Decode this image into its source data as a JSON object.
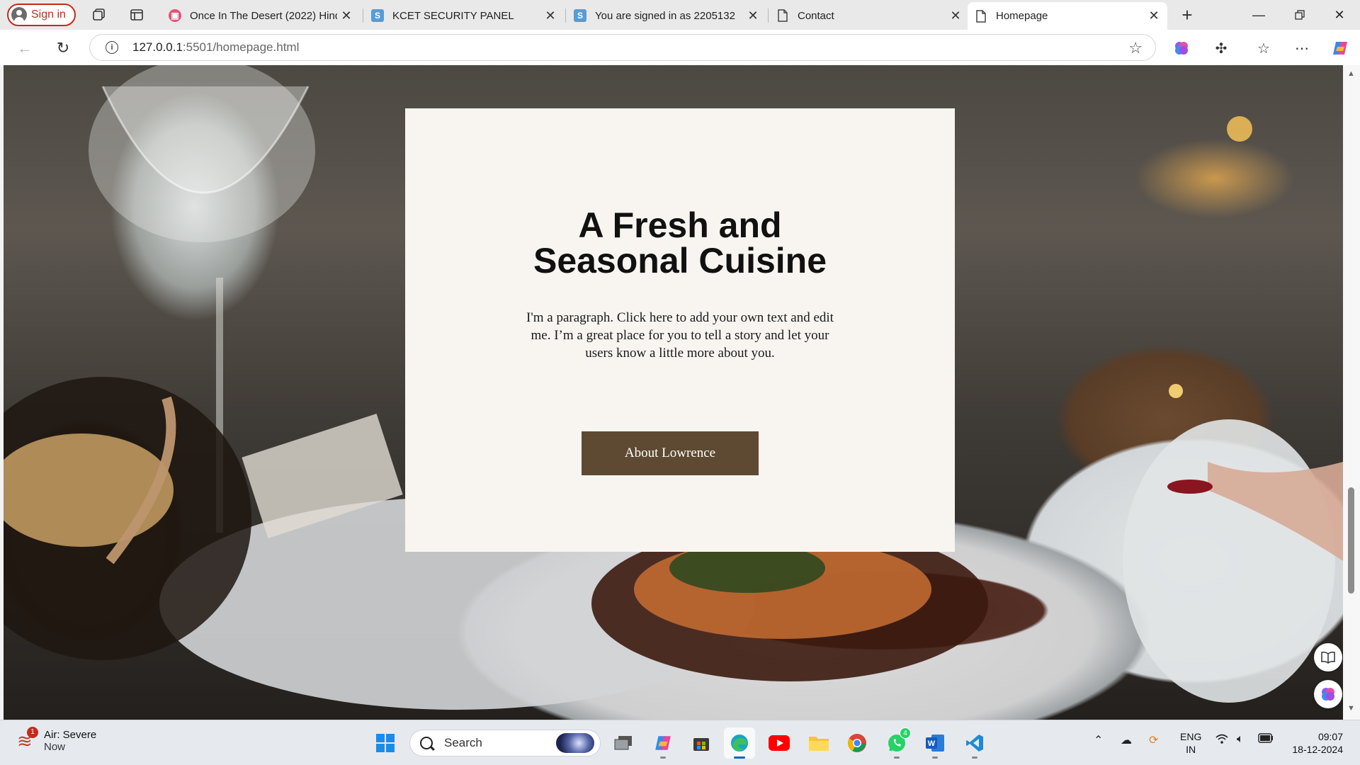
{
  "browser": {
    "signin_label": "Sign in",
    "tabs": [
      {
        "title": "Once In The Desert (2022) Hindi",
        "favicon": "film-icon",
        "favicon_color": "#e0567a"
      },
      {
        "title": "KCET SECURITY PANEL",
        "favicon": "s-icon",
        "favicon_color": "#5a9bd4"
      },
      {
        "title": "You are signed in as 2205132",
        "favicon": "s-icon",
        "favicon_color": "#5a9bd4"
      },
      {
        "title": "Contact",
        "favicon": "page-icon",
        "favicon_color": "#555555"
      },
      {
        "title": "Homepage",
        "favicon": "page-icon",
        "favicon_color": "#555555"
      }
    ],
    "active_tab_index": 4,
    "url_host": "127.0.0.1",
    "url_rest": ":5501/homepage.html"
  },
  "page": {
    "hero": {
      "title_line1": "A Fresh and",
      "title_line2": "Seasonal Cuisine",
      "paragraph": "I'm a paragraph. Click here to add your own text and edit me. I’m a great place for you to tell a story and let your users know a little more about you.",
      "button_label": "About Lowrence",
      "button_color": "#5e4a32",
      "card_color": "#f8f5f1"
    }
  },
  "taskbar": {
    "weather_title": "Air: Severe",
    "weather_sub": "Now",
    "weather_badge": "1",
    "search_placeholder": "Search",
    "whatsapp_badge": "4",
    "lang_line1": "ENG",
    "lang_line2": "IN",
    "time": "09:07",
    "date": "18-12-2024"
  }
}
